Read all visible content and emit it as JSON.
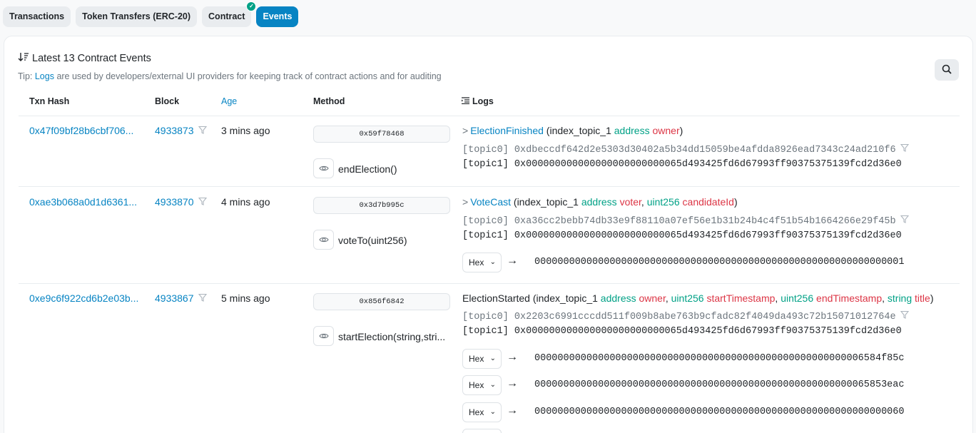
{
  "tabs": [
    {
      "label": "Transactions"
    },
    {
      "label": "Token Transfers (ERC-20)"
    },
    {
      "label": "Contract"
    },
    {
      "label": "Events"
    }
  ],
  "header": {
    "title": "Latest 13 Contract Events",
    "tip_prefix": "Tip: ",
    "tip_link": "Logs",
    "tip_suffix": " are used by developers/external UI providers for keeping track of contract actions and for auditing"
  },
  "columns": {
    "txn_hash": "Txn Hash",
    "block": "Block",
    "age": "Age",
    "method": "Method",
    "logs": "Logs"
  },
  "rows": [
    {
      "hash": "0x47f09bf28b6cbf706...",
      "block": "4933873",
      "age": "3 mins ago",
      "method_id": "0x59f78468",
      "method_name": "endElection()",
      "event_name": "ElectionFinished",
      "event_params_open": " (index_topic_1 ",
      "p1_type": "address",
      "p1_name": "owner",
      "event_params_close": ")",
      "topic0_label": "[topic0]",
      "topic0": "0xdbeccdf642d2e5303d30402a5b34dd15059be4afdda8926ead7343c24ad210f6",
      "topic1_label": "[topic1]",
      "topic1": "0x000000000000000000000000065d493425fd6d67993ff90375375139fcd2d36e0"
    },
    {
      "hash": "0xae3b068a0d1d6361...",
      "block": "4933870",
      "age": "4 mins ago",
      "method_id": "0x3d7b995c",
      "method_name": "voteTo(uint256)",
      "event_name": "VoteCast",
      "event_params_open": " (index_topic_1 ",
      "p1_type": "address",
      "p1_name": "voter",
      "sep": ", ",
      "p2_type": "uint256",
      "p2_name": "candidateId",
      "event_params_close": ")",
      "topic0_label": "[topic0]",
      "topic0": "0xa36cc2bebb74db33e9f88110a07ef56e1b31b24b4c4f51b54b1664266e29f45b",
      "topic1_label": "[topic1]",
      "topic1": "0x000000000000000000000000065d493425fd6d67993ff90375375139fcd2d36e0",
      "data": [
        {
          "format": "Hex",
          "value": "0000000000000000000000000000000000000000000000000000000000000001"
        }
      ]
    },
    {
      "hash": "0xe9c6f922cd6b2e03b...",
      "block": "4933867",
      "age": "5 mins ago",
      "method_id": "0x856f6842",
      "method_name": "startElection(string,stri...",
      "event_name": "ElectionStarted",
      "event_params_open": " (index_topic_1 ",
      "p1_type": "address",
      "p1_name": "owner",
      "sep": ", ",
      "p2_type": "uint256",
      "p2_name": "startTimestamp",
      "p3_type": "uint256",
      "p3_name": "endTimestamp",
      "p4_type": "string",
      "p4_name": "title",
      "event_params_close": ")",
      "topic0_label": "[topic0]",
      "topic0": "0x2203c6991cccdd511f009b8abe763b9cfadc82f4049da493c72b15071012764e",
      "topic1_label": "[topic1]",
      "topic1": "0x000000000000000000000000065d493425fd6d67993ff90375375139fcd2d36e0",
      "data": [
        {
          "format": "Hex",
          "value": "000000000000000000000000000000000000000000000000000000006584f85c"
        },
        {
          "format": "Hex",
          "value": "0000000000000000000000000000000000000000000000000000000065853eac"
        },
        {
          "format": "Hex",
          "value": "0000000000000000000000000000000000000000000000000000000000000060"
        }
      ]
    }
  ],
  "icons": {
    "sort": "sort-descending-icon",
    "search": "search-icon",
    "filter": "filter-icon",
    "eye": "eye-icon",
    "logs": "list-icon",
    "check": "check-icon",
    "arrow": "arrow-right-icon",
    "chevron": "chevron-right-icon"
  },
  "colors": {
    "accent": "#0784c3",
    "type": "#00a186",
    "name": "#dc3545"
  }
}
